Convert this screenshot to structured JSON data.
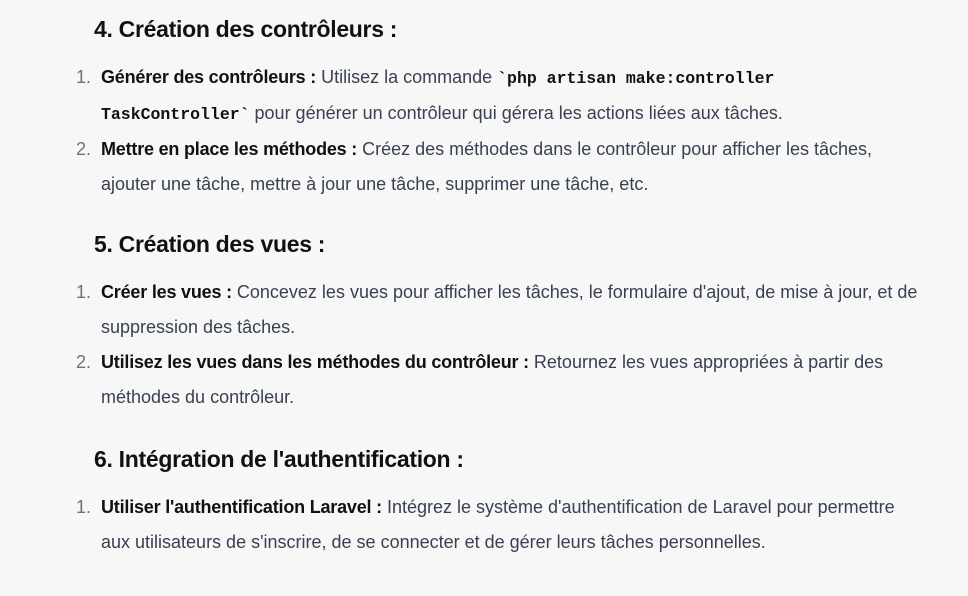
{
  "sections": [
    {
      "heading": "4. Création des contrôleurs :",
      "items": [
        {
          "num": "1.",
          "title": "Générer des contrôleurs :",
          "text_before": " Utilisez la commande ",
          "code": "`php artisan make:controller TaskController`",
          "text_after": " pour générer un contrôleur qui gérera les actions liées aux tâches."
        },
        {
          "num": "2.",
          "title": "Mettre en place les méthodes :",
          "text": " Créez des méthodes dans le contrôleur pour afficher les tâches, ajouter une tâche, mettre à jour une tâche, supprimer une tâche, etc."
        }
      ]
    },
    {
      "heading": "5. Création des vues :",
      "items": [
        {
          "num": "1.",
          "title": "Créer les vues :",
          "text": " Concevez les vues pour afficher les tâches, le formulaire d'ajout, de mise à jour, et de suppression des tâches."
        },
        {
          "num": "2.",
          "title": "Utilisez les vues dans les méthodes du contrôleur :",
          "text": " Retournez les vues appropriées à partir des méthodes du contrôleur."
        }
      ]
    },
    {
      "heading": "6. Intégration de l'authentification :",
      "items": [
        {
          "num": "1.",
          "title": "Utiliser l'authentification Laravel :",
          "text": " Intégrez le système d'authentification de Laravel pour permettre aux utilisateurs de s'inscrire, de se connecter et de gérer leurs tâches personnelles."
        }
      ]
    }
  ]
}
